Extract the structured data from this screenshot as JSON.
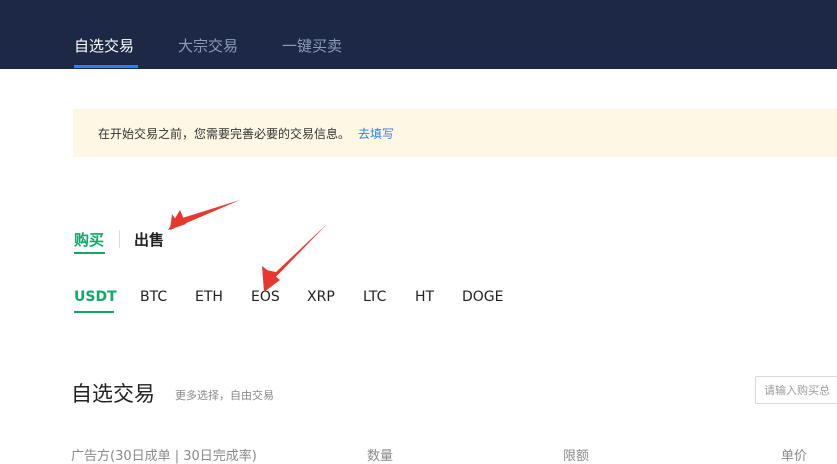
{
  "nav": {
    "tabs": [
      {
        "label": "自选交易",
        "active": true
      },
      {
        "label": "大宗交易",
        "active": false
      },
      {
        "label": "一键买卖",
        "active": false
      }
    ]
  },
  "notice": {
    "text": "在开始交易之前，您需要完善必要的交易信息。",
    "link": "去填写"
  },
  "side_tabs": {
    "buy": "购买",
    "sell": "出售",
    "selected": "购买"
  },
  "coins": {
    "items": [
      "USDT",
      "BTC",
      "ETH",
      "EOS",
      "XRP",
      "LTC",
      "HT",
      "DOGE"
    ],
    "selected": "USDT"
  },
  "section": {
    "title": "自选交易",
    "subtitle": "更多选择，自由交易"
  },
  "search": {
    "placeholder": "请输入购买总"
  },
  "table": {
    "headers": [
      "广告方(30日成单 | 30日完成率)",
      "数量",
      "限额",
      "单价"
    ]
  },
  "colors": {
    "topbar": "#1c2846",
    "accent_blue": "#2f7ef2",
    "accent_green": "#0fa865",
    "notice_bg": "#fdf7e4",
    "annotation_red": "#e8372f"
  }
}
